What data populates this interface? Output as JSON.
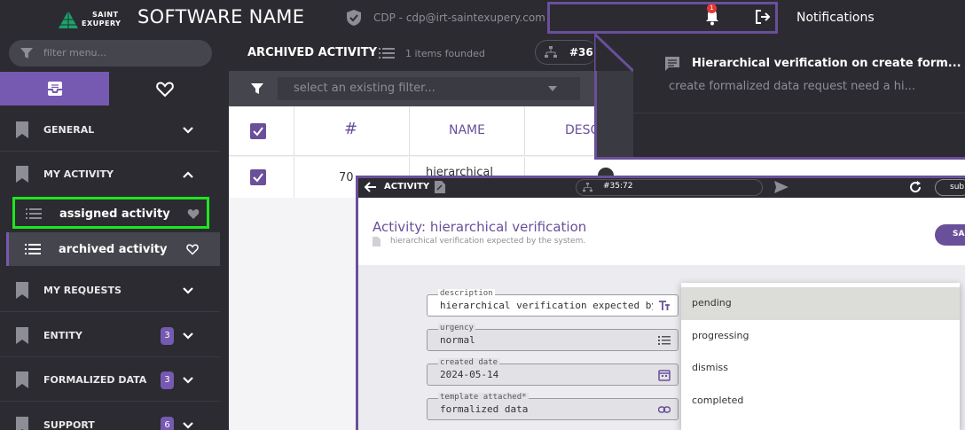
{
  "header": {
    "logo_line1": "SAINT",
    "logo_line2": "EXUPERY",
    "app_title": "SOFTWARE NAME",
    "user": "CDP - cdp@irt-saintexupery.com",
    "notification_count": "1",
    "notifications_title": "Notifications"
  },
  "sidebar": {
    "filter_placeholder": "filter menu...",
    "sections": [
      {
        "label": "GENERAL",
        "expanded": false
      },
      {
        "label": "MY ACTIVITY",
        "expanded": true
      },
      {
        "label": "MY REQUESTS",
        "expanded": false
      },
      {
        "label": "ENTITY",
        "count": "3",
        "expanded": false
      },
      {
        "label": "FORMALIZED DATA",
        "count": "3",
        "expanded": false
      },
      {
        "label": "SUPPORT",
        "count": "6",
        "expanded": false
      }
    ],
    "sub_items": [
      {
        "label": "assigned activity"
      },
      {
        "label": "archived activity"
      }
    ]
  },
  "main": {
    "title": "ARCHIVED ACTIVITY",
    "count_text": "1 items founded",
    "search_value": "#36",
    "filter_placeholder": "select an existing filter...",
    "columns": [
      "#",
      "NAME",
      "DESC"
    ],
    "row": {
      "id": "70",
      "name": "hierarchical"
    }
  },
  "notification": {
    "title": "Hierarchical verification on create form...",
    "body": "create formalized data request need a hi..."
  },
  "dialog": {
    "bar_title": "ACTIVITY",
    "search_value": "#35:72",
    "sub_btn": "sub",
    "title": "Activity: hierarchical verification",
    "subtitle": "hierarchical verification expected by the system.",
    "save_btn": "SA",
    "fields": [
      {
        "label": "description",
        "value": "hierarchical verification expected by the syste"
      },
      {
        "label": "urgency",
        "value": "normal"
      },
      {
        "label": "created date",
        "value": "2024-05-14"
      },
      {
        "label": "template attached*",
        "value": "formalized data"
      }
    ],
    "dropdown_options": [
      "pending",
      "progressing",
      "dismiss",
      "completed"
    ]
  },
  "colors": {
    "accent": "#6a4f9a",
    "highlight_green": "#1ee61e",
    "dark_bg": "#2b2b31",
    "badge_red": "#e53935"
  }
}
